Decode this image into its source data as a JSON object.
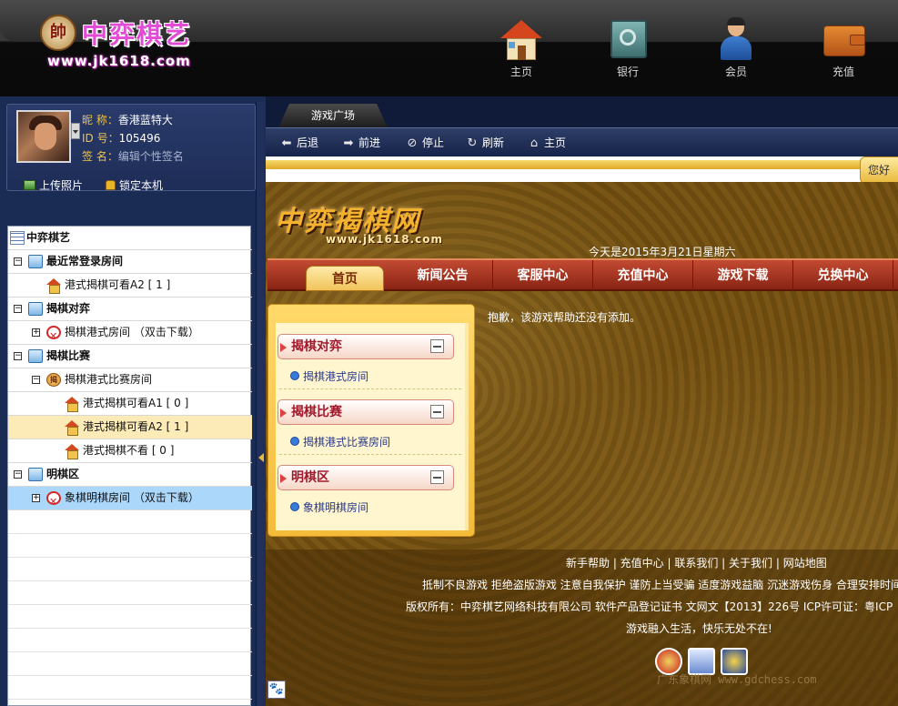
{
  "header": {
    "logo_seal": "帥",
    "logo_name": "中弈棋艺",
    "logo_url": "www.jk1618.com",
    "nav": [
      {
        "label": "主页",
        "icon": "home-icon"
      },
      {
        "label": "银行",
        "icon": "safe-icon"
      },
      {
        "label": "会员",
        "icon": "member-icon"
      },
      {
        "label": "充值",
        "icon": "wallet-icon"
      }
    ]
  },
  "profile": {
    "nick_label": "昵  称：",
    "nick": "香港蓝特大",
    "id_label": "ID  号：",
    "id": "105496",
    "sign_label": "签  名：",
    "sign": "编辑个性签名",
    "upload": "上传照片",
    "lock": "锁定本机"
  },
  "tree": {
    "root": "中弈棋艺",
    "rows": [
      {
        "text": "最近常登录房间",
        "bold": true
      },
      {
        "text": "港式揭棋可看A2 [ 1 ]"
      },
      {
        "text": "揭棋对弈",
        "bold": true
      },
      {
        "text": "揭棋港式房间 （双击下载）"
      },
      {
        "text": "揭棋比赛",
        "bold": true
      },
      {
        "text": "揭棋港式比赛房间"
      },
      {
        "text": "港式揭棋可看A1 [ 0 ]"
      },
      {
        "text": "港式揭棋可看A2 [ 1 ]"
      },
      {
        "text": "港式揭棋不看 [ 0 ]"
      },
      {
        "text": "明棋区",
        "bold": true
      },
      {
        "text": "象棋明棋房间 （双击下载）"
      }
    ]
  },
  "tabs": {
    "active": "游戏广场"
  },
  "toolbar": {
    "back": "后退",
    "forward": "前进",
    "stop": "停止",
    "refresh": "刷新",
    "home": "主页"
  },
  "site": {
    "greet": "您好",
    "logo_text": "中弈揭棋网",
    "logo_url": "www.jk1618.com",
    "today": "今天是2015年3月21日星期六",
    "nav": [
      "首页",
      "新闻公告",
      "客服中心",
      "充值中心",
      "游戏下载",
      "兑换中心"
    ],
    "menu": [
      {
        "title": "揭棋对弈",
        "item": "揭棋港式房间"
      },
      {
        "title": "揭棋比赛",
        "item": "揭棋港式比赛房间"
      },
      {
        "title": "明棋区",
        "item": "象棋明棋房间"
      }
    ],
    "notice": "抱歉，该游戏帮助还没有添加。",
    "footer": {
      "links": "新手帮助 | 充值中心 | 联系我们 | 关于我们 | 网站地图",
      "advice": "抵制不良游戏  拒绝盗版游戏  注意自我保护  谨防上当受骗  适度游戏益脑  沉迷游戏伤身  合理安排时间",
      "copyright": "版权所有：中弈棋艺网络科技有限公司  软件产品登记证书  文网文【2013】226号  ICP许可证：粤ICP",
      "slogan": "游戏融入生活，快乐无处不在!",
      "watermark": "广东象棋网 www.gdchess.com"
    }
  },
  "colors": {
    "accent": "#e24bd5",
    "panel": "#1b2c54",
    "gold": "#f4b22d",
    "nav_red": "#b23a24"
  }
}
